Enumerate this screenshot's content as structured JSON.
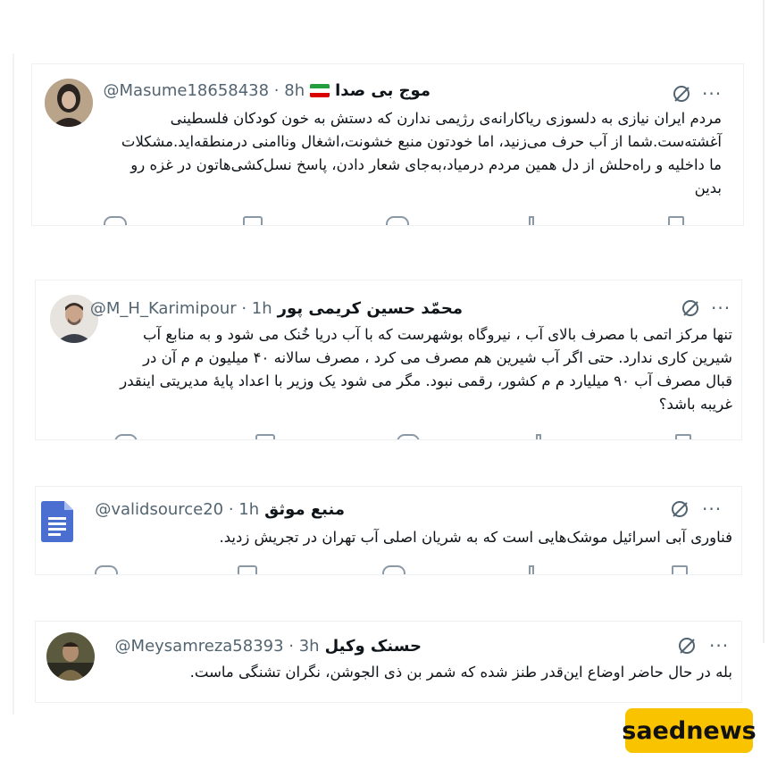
{
  "tweets": [
    {
      "name": "موج بی صدا",
      "handle": "@Masume18658438 · 8h",
      "text": "مردم ایران نیازی به دلسوزی ریاکارانه‌ی رژیمی ندارن که دستش به خون کودکان فلسطینی آغشته‌ست.شما از آب حرف می‌زنید، اما خودتون منبع خشونت،اشغال وناامنی درمنطقه‌اید.مشکلات ما داخلیه و راه‌حلش از دل همین مردم درمیاد،به‌جای شعار دادن، پاسخ نسل‌کشی‌هاتون در غزه رو بدین",
      "avatar_icon": "profile-photo",
      "flag_icon": "iran-flag-icon"
    },
    {
      "name": "محمّد حسین کریمی پور",
      "handle": "@M_H_Karimipour · 1h",
      "text": "تنها مرکز اتمی با مصرف بالای آب ، نیروگاه بوشهرست که با آب دریا خُنک می شود و به منابع آب شیرین کاری ندارد. حتی اگر آب شیرین هم مصرف می کرد ، مصرف سالانه ۴۰ میلیون م م آن در قبال مصرف آب ۹۰ میلیارد م م کشور، رقمی نبود.  مگر می شود یک وزیر با اعداد پایهٔ مدیریتی اینقدر غریبه باشد؟",
      "avatar_icon": "profile-photo"
    },
    {
      "name": "منبع موثق",
      "handle": "@validsource20 · 1h",
      "text": "فناوری آبی اسرائیل موشک‌هایی است که به شریان اصلی آب تهران در تجریش زدید.",
      "avatar_icon": "document-icon"
    },
    {
      "name": "حسنک وکیل",
      "handle": "@Meysamreza58393 · 3h",
      "text": "بله در حال حاضر اوضاع این‌قدر طنز شده که شمر بن ذی الجوشن، نگران تشنگی ماست.",
      "avatar_icon": "profile-photo"
    }
  ],
  "icons": {
    "grok": "grok-icon",
    "more": "more-icon"
  },
  "more_glyph": "···",
  "watermark": "saednews",
  "colors": {
    "handle": "#536471",
    "logo_bg": "#f9c300",
    "doc_blue": "#4a6fd1"
  }
}
